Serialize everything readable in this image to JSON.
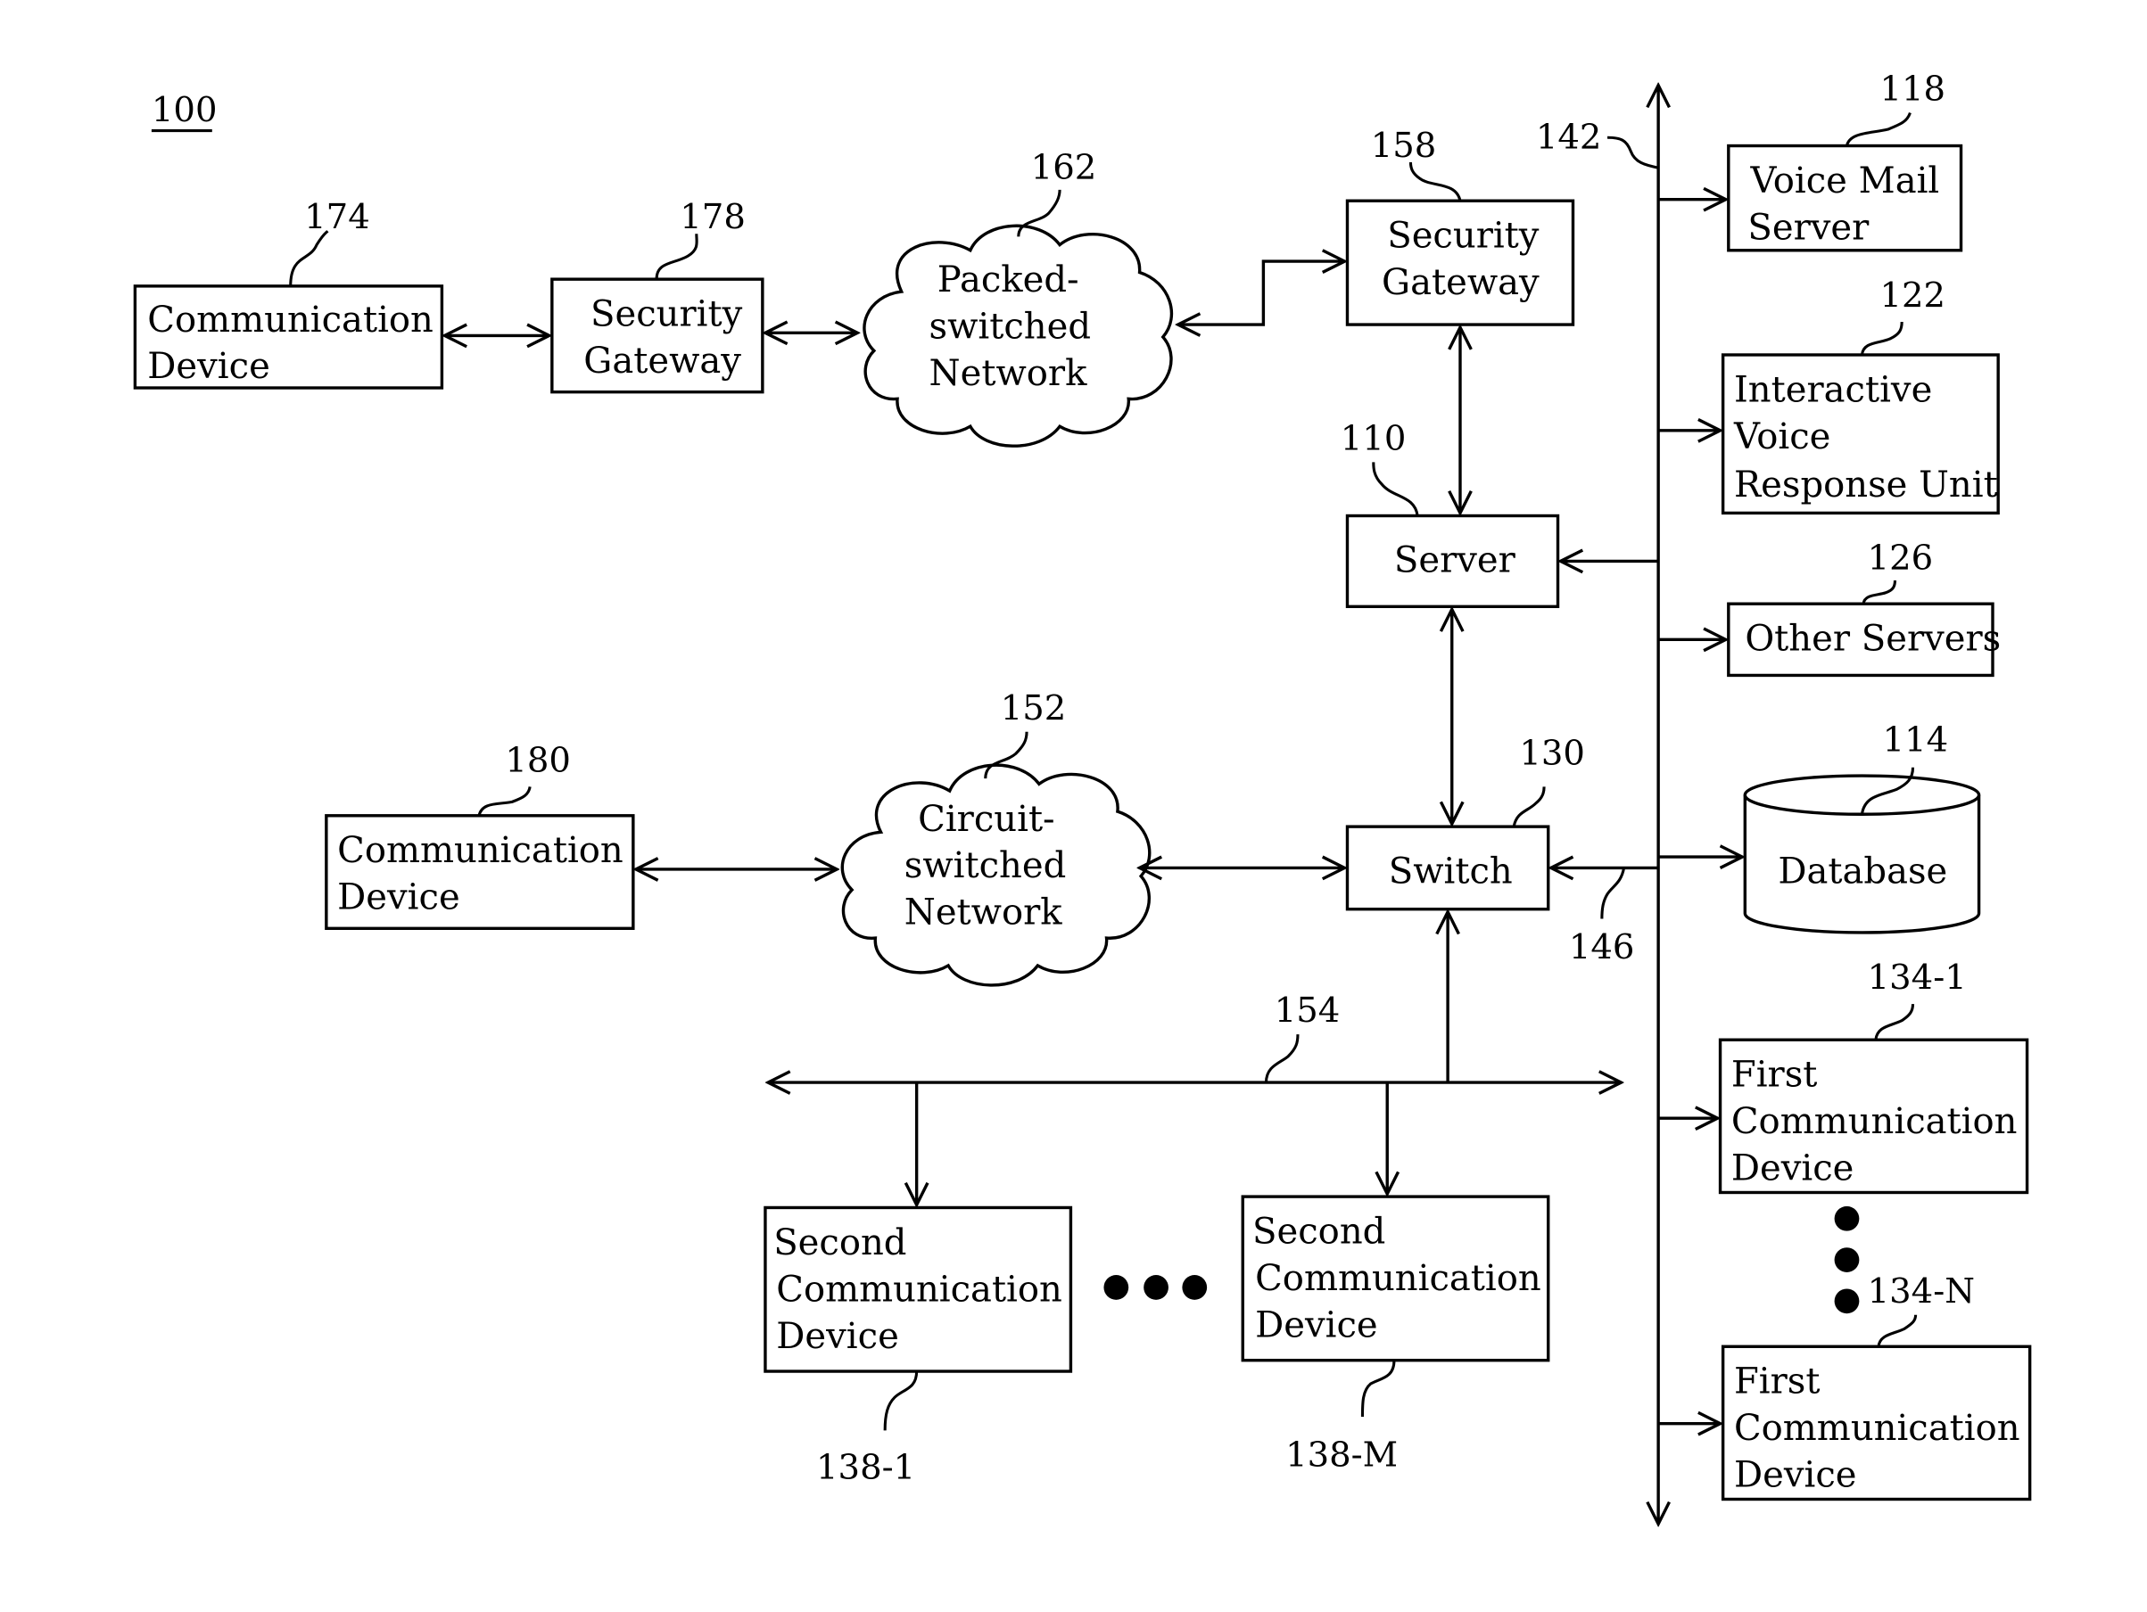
{
  "figure": {
    "ref": "100"
  },
  "colors": {
    "stroke": "#000000",
    "background": "#ffffff"
  },
  "nodes": {
    "comm_174": {
      "ref": "174",
      "lines": [
        "Communication",
        "Device"
      ]
    },
    "sg_178": {
      "ref": "178",
      "lines": [
        "Security",
        "Gateway"
      ]
    },
    "psn_162": {
      "ref": "162",
      "lines": [
        "Packed-",
        "switched",
        "Network"
      ]
    },
    "sg_158": {
      "ref": "158",
      "lines": [
        "Security",
        "Gateway"
      ]
    },
    "server_110": {
      "ref": "110",
      "lines": [
        "Server"
      ]
    },
    "bus_142": {
      "ref": "142"
    },
    "vm_118": {
      "ref": "118",
      "lines": [
        "Voice Mail",
        "Server"
      ]
    },
    "ivr_122": {
      "ref": "122",
      "lines": [
        "Interactive",
        "Voice",
        "Response Unit"
      ]
    },
    "other_126": {
      "ref": "126",
      "lines": [
        "Other Servers"
      ]
    },
    "comm_180": {
      "ref": "180",
      "lines": [
        "Communication",
        "Device"
      ]
    },
    "csn_152": {
      "ref": "152",
      "lines": [
        "Circuit-",
        "switched",
        "Network"
      ]
    },
    "switch_130": {
      "ref": "130",
      "lines": [
        "Switch"
      ]
    },
    "link_146": {
      "ref": "146"
    },
    "db_114": {
      "ref": "114",
      "lines": [
        "Database"
      ]
    },
    "first_134_1": {
      "ref": "134-1",
      "lines": [
        "First",
        "Communication",
        "Device"
      ]
    },
    "first_134_n": {
      "ref": "134-N",
      "lines": [
        "First",
        "Communication",
        "Device"
      ]
    },
    "bus_154": {
      "ref": "154"
    },
    "second_138_1": {
      "ref": "138-1",
      "lines": [
        "Second",
        "Communication",
        "Device"
      ]
    },
    "second_138_m": {
      "ref": "138-M",
      "lines": [
        "Second",
        "Communication",
        "Device"
      ]
    }
  }
}
